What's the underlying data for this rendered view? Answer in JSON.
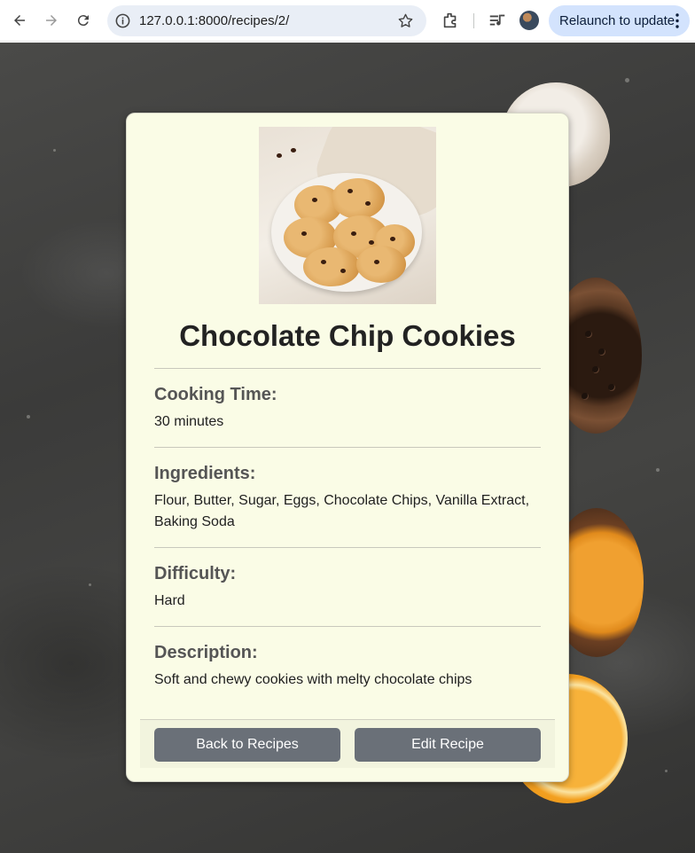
{
  "browser": {
    "url": "127.0.0.1:8000/recipes/2/",
    "relaunch_label": "Relaunch to update"
  },
  "recipe": {
    "title": "Chocolate Chip Cookies",
    "cooking_time_label": "Cooking Time:",
    "cooking_time": "30 minutes",
    "ingredients_label": "Ingredients:",
    "ingredients": "Flour, Butter, Sugar, Eggs, Chocolate Chips, Vanilla Extract, Baking Soda",
    "difficulty_label": "Difficulty:",
    "difficulty": "Hard",
    "description_label": "Description:",
    "description": "Soft and chewy cookies with melty chocolate chips"
  },
  "actions": {
    "back_label": "Back to Recipes",
    "edit_label": "Edit Recipe"
  },
  "colors": {
    "card_bg": "#fafce6",
    "button_bg": "#6a7078",
    "label_color": "#555555"
  }
}
